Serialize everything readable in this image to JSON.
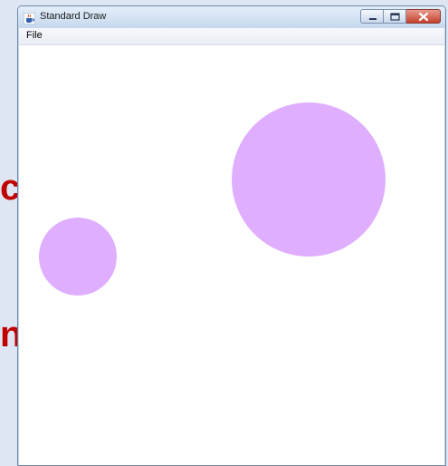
{
  "window": {
    "title": "Standard Draw",
    "icon": "java-coffee-cup-icon"
  },
  "controls": {
    "minimize_icon": "minimize-icon",
    "maximize_icon": "maximize-icon",
    "close_icon": "close-icon"
  },
  "menubar": {
    "items": [
      {
        "label": "File"
      }
    ]
  },
  "canvas": {
    "background": "#ffffff",
    "circle_fill": "#e0aeff",
    "shapes": [
      {
        "type": "filled-circle",
        "color": "#e0aeff"
      },
      {
        "type": "filled-circle",
        "color": "#e0aeff"
      }
    ]
  },
  "background": {
    "accent_color": "#c00000",
    "glyphs": [
      "c",
      "n"
    ]
  }
}
